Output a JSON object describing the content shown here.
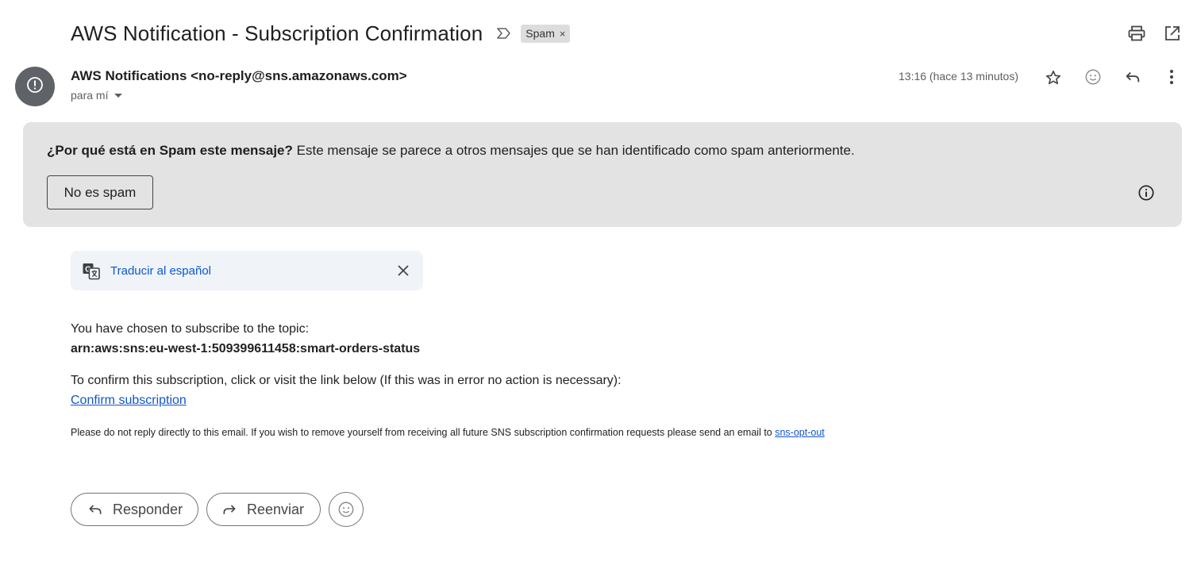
{
  "email": {
    "subject": "AWS Notification - Subscription Confirmation",
    "label": {
      "name": "Spam",
      "remove_glyph": "×"
    },
    "sender": "AWS Notifications <no-reply@sns.amazonaws.com>",
    "recipient": "para mí",
    "time": "13:16 (hace 13 minutos)"
  },
  "icons": {
    "importance": "importance-marker-icon",
    "print": "print-icon",
    "open_new_window": "open-in-new-window-icon",
    "avatar": "alert-icon",
    "star": "star-icon",
    "emoji": "emoji-reaction-icon",
    "reply": "reply-icon",
    "more": "more-vert-icon",
    "info": "info-icon",
    "translate": "translate-icon",
    "close": "close-icon",
    "forward": "forward-icon"
  },
  "spam_banner": {
    "question": "¿Por qué está en Spam este mensaje?",
    "explanation": " Este mensaje se parece a otros mensajes que se han identificado como spam anteriormente.",
    "not_spam_label": "No es spam"
  },
  "translate": {
    "link_label": "Traducir al español"
  },
  "body": {
    "line1": "You have chosen to subscribe to the topic:",
    "topic_arn": "arn:aws:sns:eu-west-1:509399611458:smart-orders-status",
    "line2": "To confirm this subscription, click or visit the link below (If this was in error no action is necessary):",
    "confirm_link": "Confirm subscription",
    "footer_text": "Please do not reply directly to this email. If you wish to remove yourself from receiving all future SNS subscription confirmation requests please send an email to ",
    "footer_link": "sns-opt-out"
  },
  "actions": {
    "reply_label": "Responder",
    "forward_label": "Reenviar"
  },
  "colors": {
    "spam_banner_bg": "#e3e3e3",
    "translate_bar_bg": "#f0f4f9",
    "link_blue": "#1155cc",
    "translate_blue": "#0b57d0",
    "avatar_bg": "#5f6368"
  }
}
